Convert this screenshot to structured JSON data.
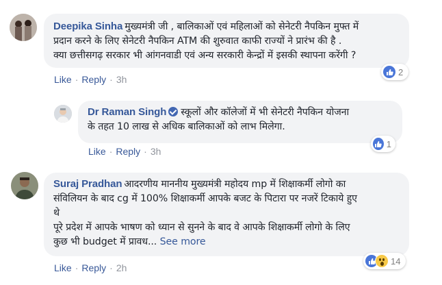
{
  "comments": [
    {
      "author": "Deepika Sinha",
      "text": "मुख्यमंत्री जी , बालिकाओं एवं महिलाओं को सेनेटरी नैपकिन मुफ्त में\nप्रदान करने के लिए सेनेटरी नैपकिन ATM की शुरुवात काफी राज्यों ने प्रारंभ की है .\nक्या छत्तीसगढ़ सरकार भी आंगनवाडी एवं अन्य सरकारी केन्द्रों में इसकी स्थापना करेंगी ?",
      "like": "Like",
      "reply": "Reply",
      "time": "3h",
      "reaction_count": "2"
    },
    {
      "author": "Dr Raman Singh",
      "verified": true,
      "text": "स्कूलों और कॉलेजों में भी सेनेटरी नैपकिन योजना\nके तहत 10 लाख से अधिक बालिकाओं को लाभ मिलेगा.",
      "like": "Like",
      "reply": "Reply",
      "time": "3h",
      "reaction_count": "1"
    },
    {
      "author": "Suraj Pradhan",
      "text": "आदरणीय माननीय मुख्यमंत्री महोदय mp में शिक्षाकर्मी लोगो का\nसंविलियन के बाद cg में 100% शिक्षाकर्मी आपके बजट के पिटारा पर नजरें टिकाये हुए\nथे\nपूरे प्रदेश में आपके भाषण को ध्यान से सुनने के बाद वे आपके शिक्षाकर्मी लोगो के लिए\nकुछ भी budget में प्रावध...",
      "see_more": "See more",
      "like": "Like",
      "reply": "Reply",
      "time": "2h",
      "reaction_count": "14"
    }
  ],
  "icons": {
    "like": "like-reaction-icon",
    "wow": "wow-reaction-icon",
    "verified": "verified-badge-icon"
  },
  "colors": {
    "link": "#365899",
    "bubble": "#f2f3f5",
    "like_blue": "#4a76d8",
    "meta_gray": "#90949c"
  }
}
